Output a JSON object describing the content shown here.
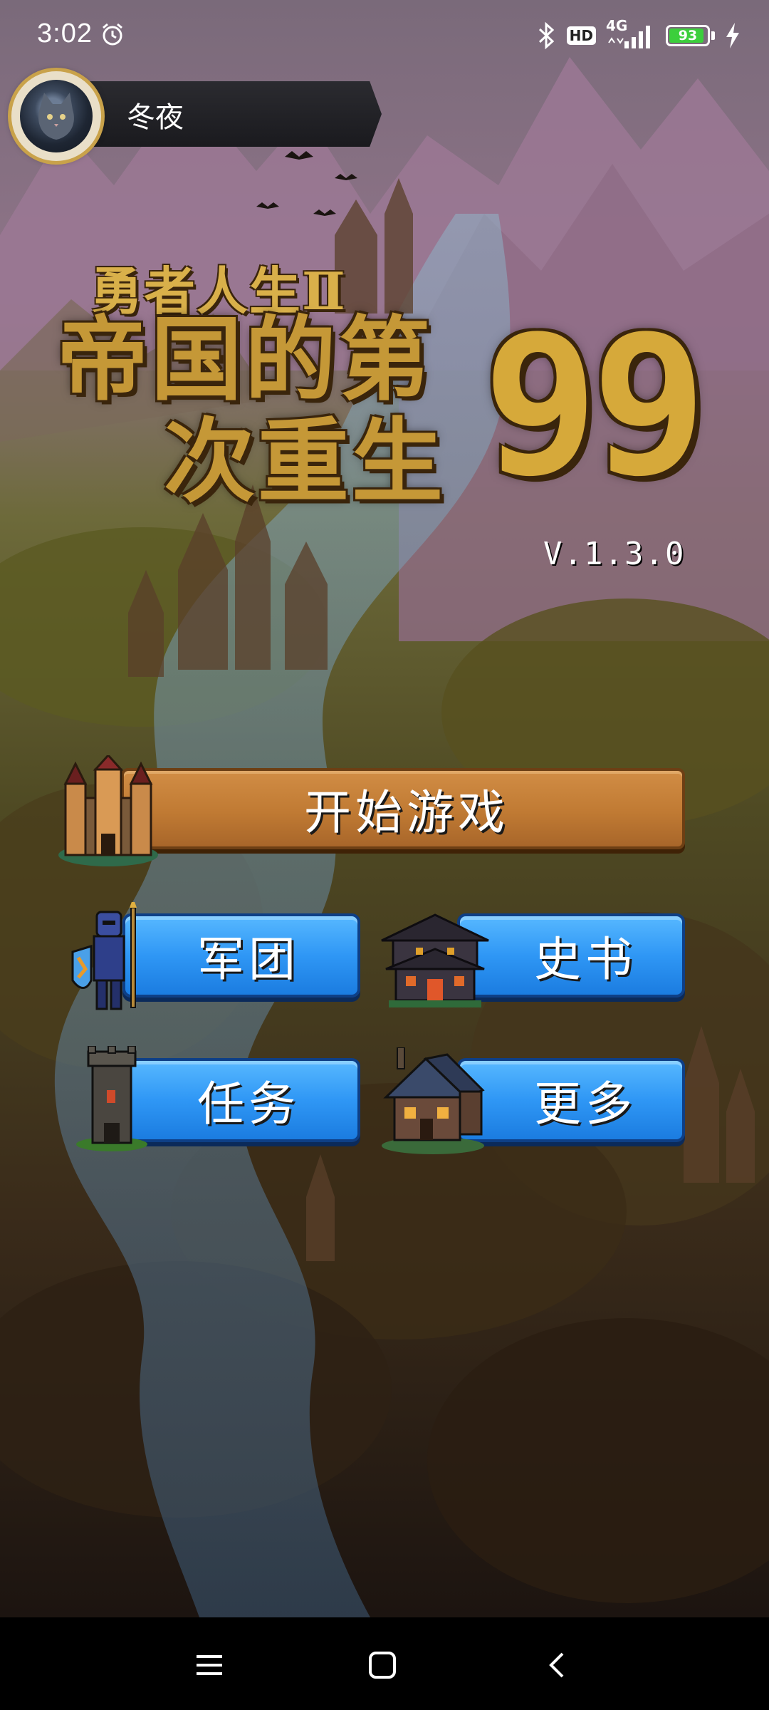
{
  "status_bar": {
    "time": "3:02",
    "alarm_icon": "alarm-clock-icon",
    "bluetooth_icon": "bluetooth-icon",
    "hd_label": "HD",
    "network_label": "4G",
    "battery_percent": "93",
    "battery_level": 0.93,
    "charging_icon": "lightning-bolt-icon"
  },
  "profile": {
    "name": "冬夜",
    "avatar_icon": "cat-avatar-icon"
  },
  "title": {
    "subtitle": "勇者人生Ⅱ",
    "line1": "帝国的第",
    "line2": "次重生",
    "number": "99",
    "version": "V.1.3.0"
  },
  "menu": {
    "start": {
      "label": "开始游戏",
      "icon": "castle-icon"
    },
    "army": {
      "label": "军团",
      "icon": "knight-icon"
    },
    "history": {
      "label": "史书",
      "icon": "temple-icon"
    },
    "quest": {
      "label": "任务",
      "icon": "tower-icon"
    },
    "more": {
      "label": "更多",
      "icon": "house-icon"
    }
  },
  "nav": {
    "menu_icon": "recent-apps-icon",
    "home_icon": "home-square-icon",
    "back_icon": "back-chevron-icon"
  },
  "colors": {
    "start_button": "#c07a33",
    "blue_button": "#2f97f5",
    "title_gold": "#c59837",
    "battery_green": "#3ccf3c"
  }
}
